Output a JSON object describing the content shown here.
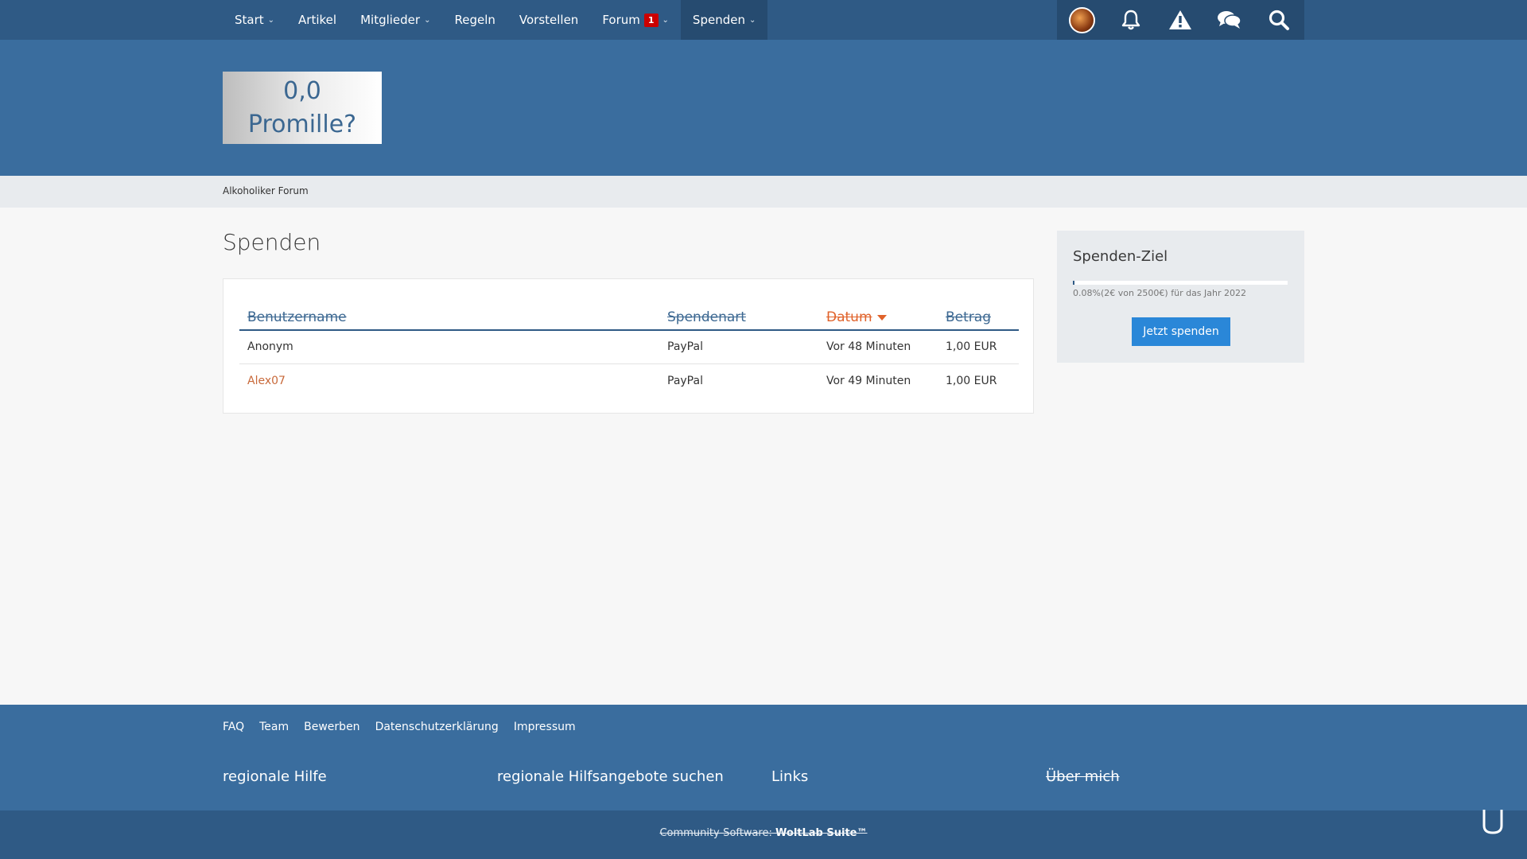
{
  "topnav": {
    "items": [
      {
        "label": "Start",
        "dropdown": true
      },
      {
        "label": "Artikel",
        "dropdown": false
      },
      {
        "label": "Mitglieder",
        "dropdown": true
      },
      {
        "label": "Regeln",
        "dropdown": false
      },
      {
        "label": "Vorstellen",
        "dropdown": false
      },
      {
        "label": "Forum",
        "dropdown": true,
        "badge": "1"
      },
      {
        "label": "Spenden",
        "dropdown": true,
        "active": true
      }
    ],
    "user_icons": [
      "avatar",
      "bell-icon",
      "warning-icon",
      "chat-bubbles-icon",
      "search-icon"
    ]
  },
  "header": {
    "logo_line1": "0,0",
    "logo_line2": "Promille?"
  },
  "breadcrumb": {
    "item": "Alkoholiker Forum"
  },
  "main": {
    "title": "Spenden",
    "table": {
      "columns": [
        "Benutzername",
        "Spendenart",
        "Datum",
        "Betrag"
      ],
      "sorted_column": "Datum",
      "rows": [
        {
          "user": "Anonym",
          "method": "PayPal",
          "date": "Vor 48 Minuten",
          "amount": "1,00 EUR"
        },
        {
          "user": "Alex07",
          "method": "PayPal",
          "date": "Vor 49 Minuten",
          "amount": "1,00 EUR"
        }
      ]
    }
  },
  "sidebar": {
    "title": "Spenden-Ziel",
    "progress_percent": 0.08,
    "progress_text": "0.08%(2€ von 2500€) für das Jahr 2022",
    "button_label": "Jetzt spenden"
  },
  "footer": {
    "links": [
      "FAQ",
      "Team",
      "Bewerben",
      "Datenschutzerklärung",
      "Impressum"
    ],
    "columns": [
      "regionale Hilfe",
      "regionale Hilfsangebote suchen",
      "Links",
      "Über mich"
    ],
    "copyright_prefix": "Community-Software:",
    "copyright_brand": "WoltLab Suite™"
  },
  "colors": {
    "topbar": "#2f5a85",
    "header": "#3a6d9e",
    "accent_orange": "#e0622a",
    "button_blue": "#2a87d8"
  }
}
